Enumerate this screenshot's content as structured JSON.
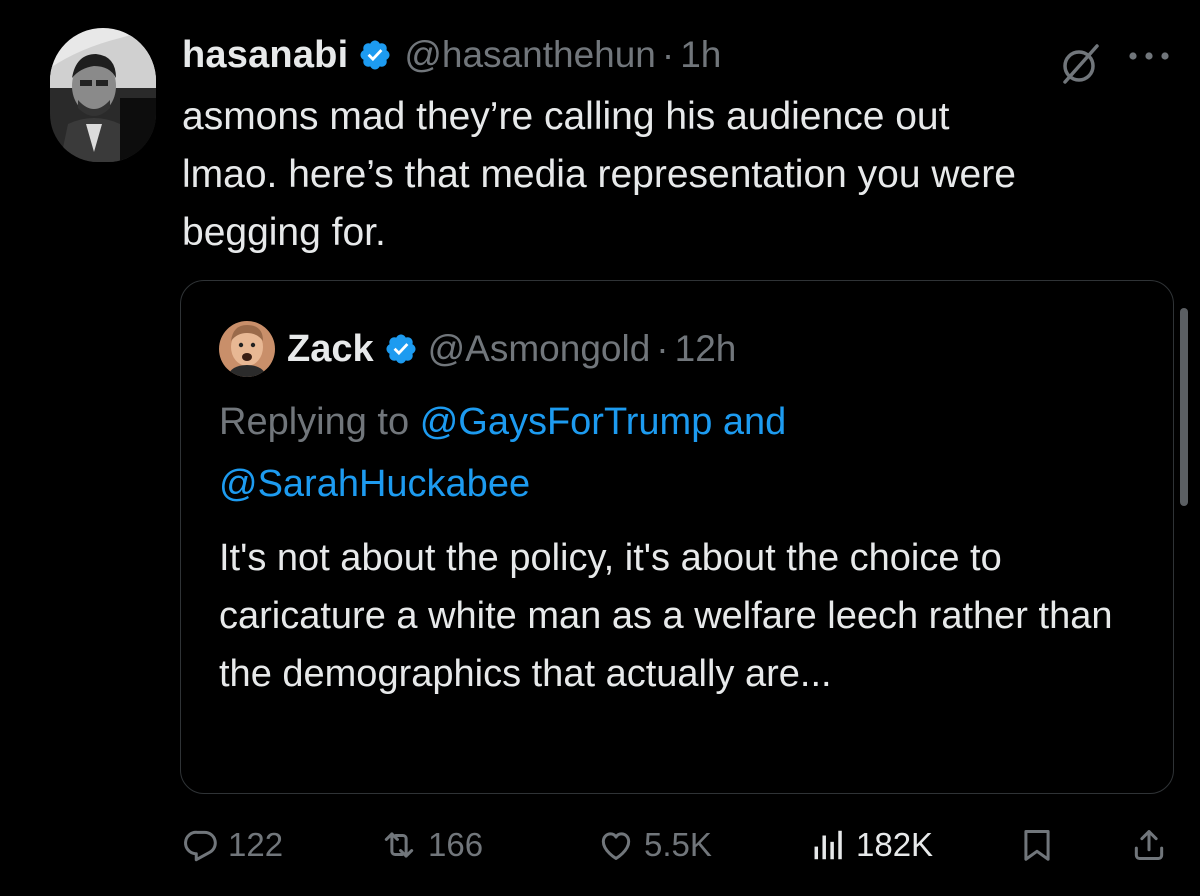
{
  "tweet": {
    "display_name": "hasanabi",
    "handle": "@hasanthehun",
    "separator": "·",
    "time": "1h",
    "text": "asmons mad they’re calling his audience out\nlmao. here’s that media representation you were\nbegging for."
  },
  "quote": {
    "display_name": "Zack",
    "handle": "@Asmongold",
    "separator": "·",
    "time": "12h",
    "replying_prefix": "Replying to",
    "mention_1": "@GaysForTrump",
    "conjunction": "and",
    "mention_2": "@SarahHuckabee",
    "text": "It's not about the policy, it's about the choice to caricature a white man as a welfare leech rather than the demographics that actually are..."
  },
  "actions": {
    "replies": "122",
    "reposts": "166",
    "likes": "5.5K",
    "views": "182K"
  },
  "colors": {
    "background": "#000000",
    "text_primary": "#e7e9ea",
    "text_secondary": "#71767b",
    "accent": "#1d9bf0",
    "border": "#2f3336"
  },
  "icons": {
    "verified": "verified-badge-icon",
    "grok": "grok-icon",
    "more": "more-dots-icon",
    "reply": "reply-icon",
    "repost": "repost-icon",
    "like": "heart-icon",
    "views": "views-icon",
    "bookmark": "bookmark-icon",
    "share": "share-icon"
  }
}
